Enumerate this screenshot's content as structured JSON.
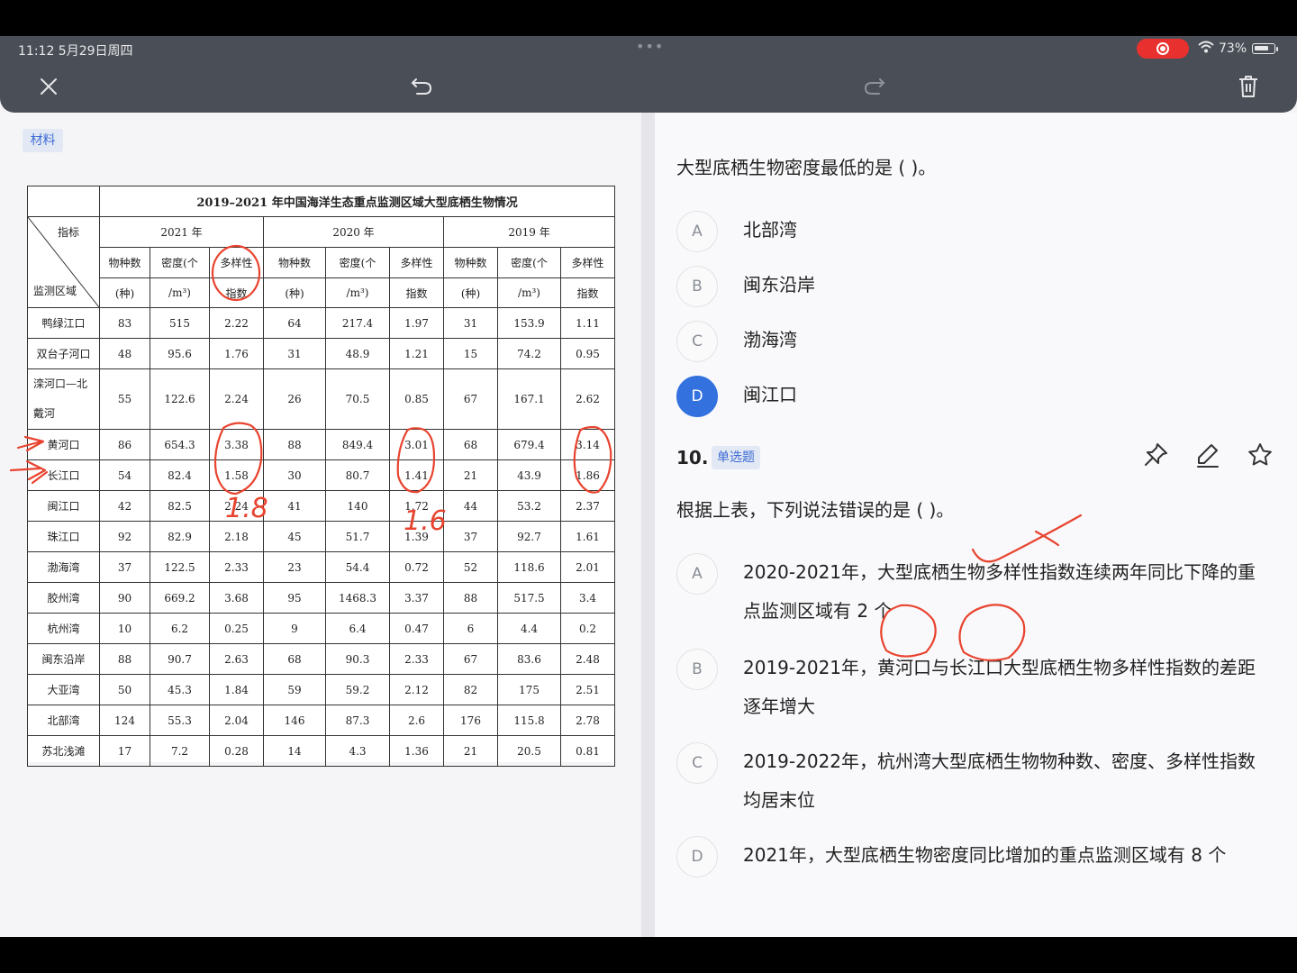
{
  "status": {
    "time": "11:12  5月29日周四",
    "battery": "73%"
  },
  "material_tag": "材料",
  "table": {
    "title": "2019–2021 年中国海洋生态重点监测区域大型底栖生物情况",
    "corner_top": "指标",
    "corner_bottom": "监测区域",
    "years": [
      "2021 年",
      "2020 年",
      "2019 年"
    ],
    "sub1": [
      "物种数",
      "密度(个",
      "多样性"
    ],
    "sub2": [
      "(种)",
      "/m³)",
      "指数"
    ],
    "rows": [
      {
        "region": "鸭绿江口",
        "v": [
          "83",
          "515",
          "2.22",
          "64",
          "217.4",
          "1.97",
          "31",
          "153.9",
          "1.11"
        ]
      },
      {
        "region": "双台子河口",
        "v": [
          "48",
          "95.6",
          "1.76",
          "31",
          "48.9",
          "1.21",
          "15",
          "74.2",
          "0.95"
        ]
      },
      {
        "region": "滦河口—北",
        "region2": "戴河",
        "v": [
          "55",
          "122.6",
          "2.24",
          "26",
          "70.5",
          "0.85",
          "67",
          "167.1",
          "2.62"
        ]
      },
      {
        "region": "黄河口",
        "v": [
          "86",
          "654.3",
          "3.38",
          "88",
          "849.4",
          "3.01",
          "68",
          "679.4",
          "3.14"
        ]
      },
      {
        "region": "长江口",
        "v": [
          "54",
          "82.4",
          "1.58",
          "30",
          "80.7",
          "1.41",
          "21",
          "43.9",
          "1.86"
        ]
      },
      {
        "region": "闽江口",
        "v": [
          "42",
          "82.5",
          "2.24",
          "41",
          "140",
          "1.72",
          "44",
          "53.2",
          "2.37"
        ]
      },
      {
        "region": "珠江口",
        "v": [
          "92",
          "82.9",
          "2.18",
          "45",
          "51.7",
          "1.39",
          "37",
          "92.7",
          "1.61"
        ]
      },
      {
        "region": "渤海湾",
        "v": [
          "37",
          "122.5",
          "2.33",
          "23",
          "54.4",
          "0.72",
          "52",
          "118.6",
          "2.01"
        ]
      },
      {
        "region": "胶州湾",
        "v": [
          "90",
          "669.2",
          "3.68",
          "95",
          "1468.3",
          "3.37",
          "88",
          "517.5",
          "3.4"
        ]
      },
      {
        "region": "杭州湾",
        "v": [
          "10",
          "6.2",
          "0.25",
          "9",
          "6.4",
          "0.47",
          "6",
          "4.4",
          "0.2"
        ]
      },
      {
        "region": "闽东沿岸",
        "v": [
          "88",
          "90.7",
          "2.63",
          "68",
          "90.3",
          "2.33",
          "67",
          "83.6",
          "2.48"
        ]
      },
      {
        "region": "大亚湾",
        "v": [
          "50",
          "45.3",
          "1.84",
          "59",
          "59.2",
          "2.12",
          "82",
          "175",
          "2.51"
        ]
      },
      {
        "region": "北部湾",
        "v": [
          "124",
          "55.3",
          "2.04",
          "146",
          "87.3",
          "2.6",
          "176",
          "115.8",
          "2.78"
        ]
      },
      {
        "region": "苏北浅滩",
        "v": [
          "17",
          "7.2",
          "0.28",
          "14",
          "4.3",
          "1.36",
          "21",
          "20.5",
          "0.81"
        ]
      }
    ]
  },
  "prev_question": {
    "stem": "大型底栖生物密度最低的是 (    )。",
    "options": [
      {
        "letter": "A",
        "text": "北部湾"
      },
      {
        "letter": "B",
        "text": "闽东沿岸"
      },
      {
        "letter": "C",
        "text": "渤海湾"
      },
      {
        "letter": "D",
        "text": "闽江口"
      }
    ]
  },
  "question": {
    "number": "10.",
    "type": "单选题",
    "stem": "根据上表，下列说法错误的是 (    )。",
    "options": [
      {
        "letter": "A",
        "text": "2020-2021年，大型底栖生物多样性指数连续两年同比下降的重点监测区域有 2 个"
      },
      {
        "letter": "B",
        "text": "2019-2021年，黄河口与长江口大型底栖生物多样性指数的差距逐年增大"
      },
      {
        "letter": "C",
        "text": "2019-2022年，杭州湾大型底栖生物物种数、密度、多样性指数均居末位"
      },
      {
        "letter": "D",
        "text": "2021年，大型底栖生物密度同比增加的重点监测区域有 8 个"
      }
    ]
  },
  "annotations": {
    "note1": "1.8",
    "note2": "1.6"
  },
  "colors": {
    "accent": "#3271de",
    "ink": "#e8432e",
    "toolbar": "#4a4f57"
  }
}
